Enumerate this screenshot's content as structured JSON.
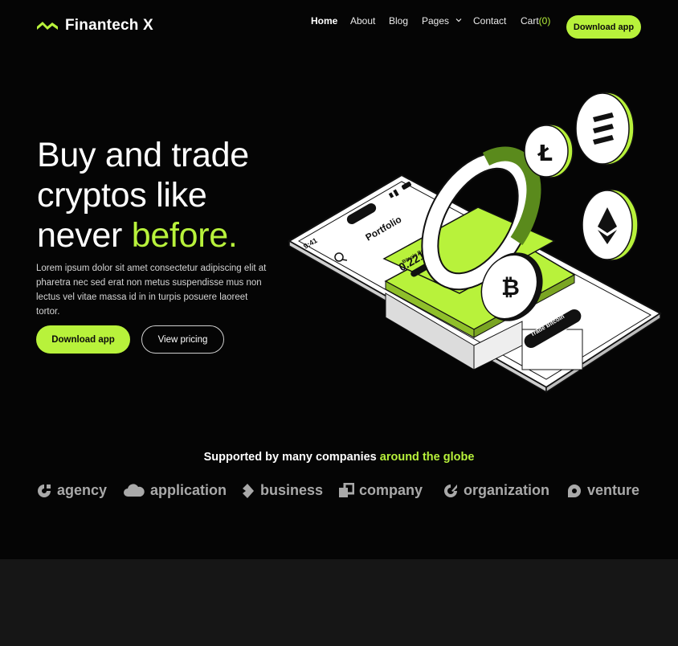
{
  "brand": {
    "name": "Finantech X",
    "accent": "#b8f23b"
  },
  "nav": {
    "home": "Home",
    "about": "About",
    "blog": "Blog",
    "pages": "Pages",
    "contact": "Contact",
    "cart_label": "Cart",
    "cart_count": "(0)",
    "cta": "Download app"
  },
  "hero": {
    "line1": "Buy and trade",
    "line2": "cryptos like",
    "line3_plain": "never ",
    "line3_accent": "before.",
    "description": "Lorem ipsum dolor sit amet consectetur adipiscing elit at pharetra nec sed erat non metus suspendisse mus non lectus vel vitae massa id in in turpis posuere laoreet tortor.",
    "primary_button": "Download app",
    "secondary_button": "View pricing"
  },
  "phone": {
    "time": "9:41",
    "title": "Portfolio",
    "balance_label": "Bitcoin Balance",
    "balance_value": "0.2217",
    "trade_button": "Trade Bitcoin"
  },
  "supported": {
    "prefix": "Supported by many companies ",
    "accent": "around the globe"
  },
  "companies": [
    {
      "name": "agency",
      "icon": "agency-logo-icon"
    },
    {
      "name": "application",
      "icon": "cloud-logo-icon"
    },
    {
      "name": "business",
      "icon": "business-logo-icon"
    },
    {
      "name": "company",
      "icon": "company-logo-icon"
    },
    {
      "name": "organization",
      "icon": "organization-logo-icon"
    },
    {
      "name": "venture",
      "icon": "venture-logo-icon"
    }
  ]
}
